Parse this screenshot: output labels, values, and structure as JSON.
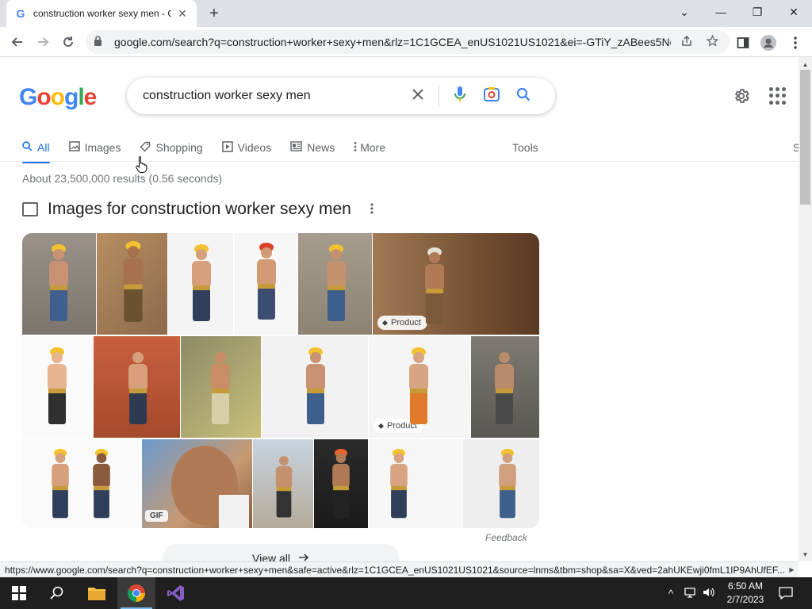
{
  "browser": {
    "tab": {
      "favicon": "G",
      "title": "construction worker sexy men - G",
      "close": "✕"
    },
    "new_tab": "+",
    "window_controls": {
      "tabs_menu": "⌄",
      "minimize": "—",
      "maximize": "❐",
      "close": "✕"
    },
    "url": "google.com/search?q=construction+worker+sexy+men&rlz=1C1GCEA_enUS1021US1021&ei=-GTiY_zABees5No..."
  },
  "google": {
    "logo": [
      "G",
      "o",
      "o",
      "g",
      "l",
      "e"
    ],
    "logo_colors": [
      "#4285f4",
      "#ea4335",
      "#fbbc05",
      "#4285f4",
      "#34a853",
      "#ea4335"
    ],
    "query": "construction worker sexy men",
    "tabs": [
      {
        "label": "All",
        "icon": "search-icon"
      },
      {
        "label": "Images",
        "icon": "image-icon"
      },
      {
        "label": "Shopping",
        "icon": "tag-icon"
      },
      {
        "label": "Videos",
        "icon": "play-icon"
      },
      {
        "label": "News",
        "icon": "news-icon"
      },
      {
        "label": "More",
        "icon": "kebab-icon"
      }
    ],
    "tools": "Tools",
    "sign_in_partial": "S",
    "stats": "About 23,500,000 results (0.56 seconds)",
    "images_heading": "Images for construction worker sexy men",
    "badges": {
      "product": "Product",
      "gif": "GIF"
    },
    "feedback": "Feedback",
    "view_all": "View all"
  },
  "statusbar": {
    "url": "https://www.google.com/search?q=construction+worker+sexy+men&safe=active&rlz=1C1GCEA_enUS1021US1021&source=lnms&tbm=shop&sa=X&ved=2ahUKEwji0fmL1IP9AhUfEF..."
  },
  "taskbar": {
    "time": "6:50 AM",
    "date": "2/7/2023"
  },
  "colors": {
    "accent": "#1a73e8",
    "hardhat": "#f2c230"
  }
}
